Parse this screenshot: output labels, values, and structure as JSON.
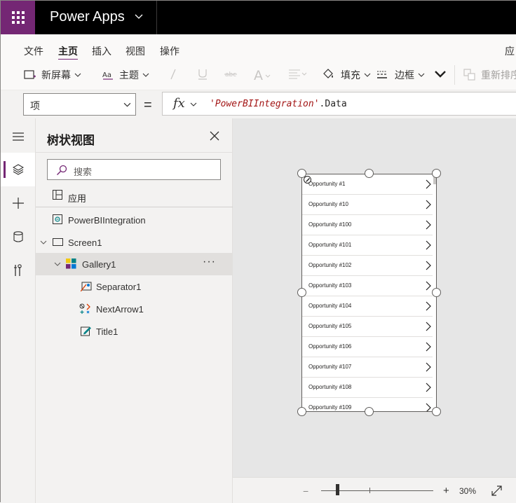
{
  "app": {
    "name": "Power Apps"
  },
  "menu": {
    "tabs": [
      "文件",
      "主页",
      "插入",
      "视图",
      "操作"
    ],
    "right_label": "应"
  },
  "ribbon": {
    "new_screen": "新屏幕",
    "theme": "主题",
    "fill": "填充",
    "border": "边框",
    "reorder": "重新排序"
  },
  "formula_bar": {
    "property": "项",
    "equals": "=",
    "fx": "fx",
    "formula_string": "'PowerBIIntegration'",
    "formula_rest": ".Data"
  },
  "tree_view": {
    "title": "树状视图",
    "search_placeholder": "搜索",
    "app_label": "应用",
    "nodes": {
      "powerbi": "PowerBIIntegration",
      "screen1": "Screen1",
      "gallery1": "Gallery1",
      "separator1": "Separator1",
      "nextarrow1": "NextArrow1",
      "title1": "Title1"
    },
    "more": "···"
  },
  "gallery": {
    "items": [
      "Opportunity #1",
      "Opportunity #10",
      "Opportunity #100",
      "Opportunity #101",
      "Opportunity #102",
      "Opportunity #103",
      "Opportunity #104",
      "Opportunity #105",
      "Opportunity #106",
      "Opportunity #107",
      "Opportunity #108",
      "Opportunity #109"
    ]
  },
  "zoom": {
    "minus": "−",
    "plus": "+",
    "value": "30%"
  },
  "colors": {
    "brand": "#742774",
    "canvas": "#e6e6e6"
  },
  "icons": [
    "waffle-icon",
    "chevron-down-icon",
    "hamburger-icon",
    "layers-icon",
    "plus-icon",
    "database-icon",
    "tools-icon",
    "close-icon",
    "search-icon",
    "fullscreen-icon"
  ]
}
